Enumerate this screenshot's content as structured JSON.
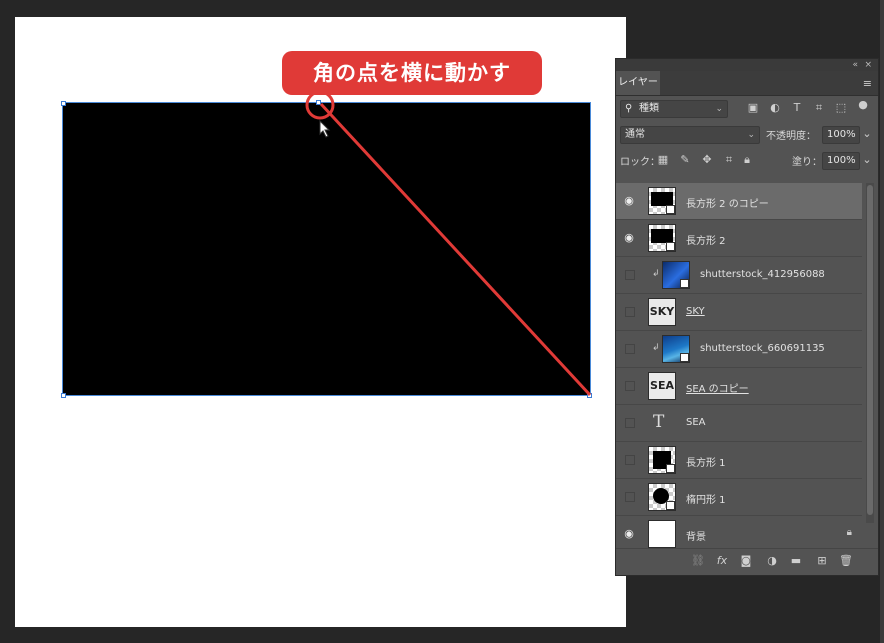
{
  "callout": {
    "text": "角の点を横に動かす",
    "color": "#e03a37"
  },
  "panel": {
    "tab_label": "レイヤー",
    "filter": {
      "value": "種類"
    },
    "blend_mode": {
      "value": "通常"
    },
    "opacity": {
      "label": "不透明度：",
      "value": "100%"
    },
    "lock": {
      "label": "ロック："
    },
    "fill": {
      "label": "塗り：",
      "value": "100%"
    },
    "layers": [
      {
        "name": "長方形 2 のコピー",
        "visible": true,
        "selected": true,
        "thumb": "shape-rect"
      },
      {
        "name": "長方形 2",
        "visible": true,
        "selected": false,
        "thumb": "shape-rect"
      },
      {
        "name": "shutterstock_412956088",
        "visible": false,
        "clipped": true,
        "thumb": "photo"
      },
      {
        "name": "SKY",
        "visible": false,
        "thumb": "text",
        "thumb_text": "SKY"
      },
      {
        "name": "shutterstock_660691135",
        "visible": false,
        "clipped": true,
        "thumb": "photo"
      },
      {
        "name": "SEA のコピー",
        "visible": false,
        "thumb": "text",
        "thumb_text": "SEA"
      },
      {
        "name": "SEA",
        "visible": false,
        "thumb": "type"
      },
      {
        "name": "長方形 1",
        "visible": false,
        "thumb": "shape-rect"
      },
      {
        "name": "楕円形 1",
        "visible": false,
        "thumb": "shape-ellipse"
      },
      {
        "name": "背景",
        "visible": true,
        "thumb": "white",
        "locked": true
      }
    ],
    "footer_icons": [
      "link-icon",
      "fx-icon",
      "mask-icon",
      "adjustment-icon",
      "folder-icon",
      "new-layer-icon",
      "trash-icon"
    ]
  }
}
